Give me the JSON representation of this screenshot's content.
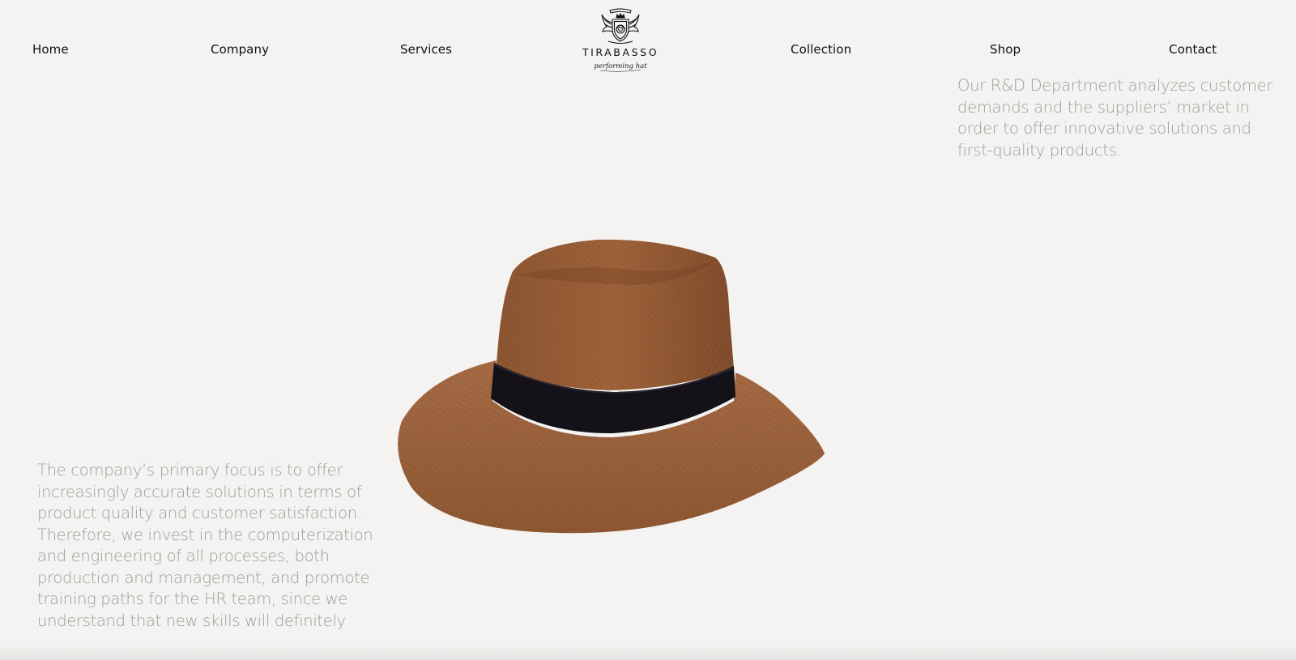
{
  "nav": {
    "items": [
      {
        "label": "Home"
      },
      {
        "label": "Company"
      },
      {
        "label": "Services"
      },
      {
        "label": "Collection"
      },
      {
        "label": "Shop"
      },
      {
        "label": "Contact"
      }
    ]
  },
  "brand": {
    "name": "TIRABASSO",
    "tagline": "performing hat"
  },
  "content": {
    "rd_paragraph": "Our R&D Department analyzes customer demands and the suppliers’ market in order to offer innovative solutions and first-quality products.",
    "focus_paragraph": "The company’s primary focus is to offer increasingly accurate solutions in terms of product quality and customer satisfaction. Therefore, we invest in the computerization and engineering of all processes, both production and management, and promote training paths for the HR team, since we understand that new skills will definitely"
  },
  "colors": {
    "background": "#f4f3f1",
    "nav_text": "#111111",
    "body_text": "#9b9c98",
    "hat_brown": "#9a5c33",
    "hat_band": "#141218"
  },
  "icons": {
    "logo": "tirabasso-crest-icon",
    "product": "fedora-hat-image"
  }
}
